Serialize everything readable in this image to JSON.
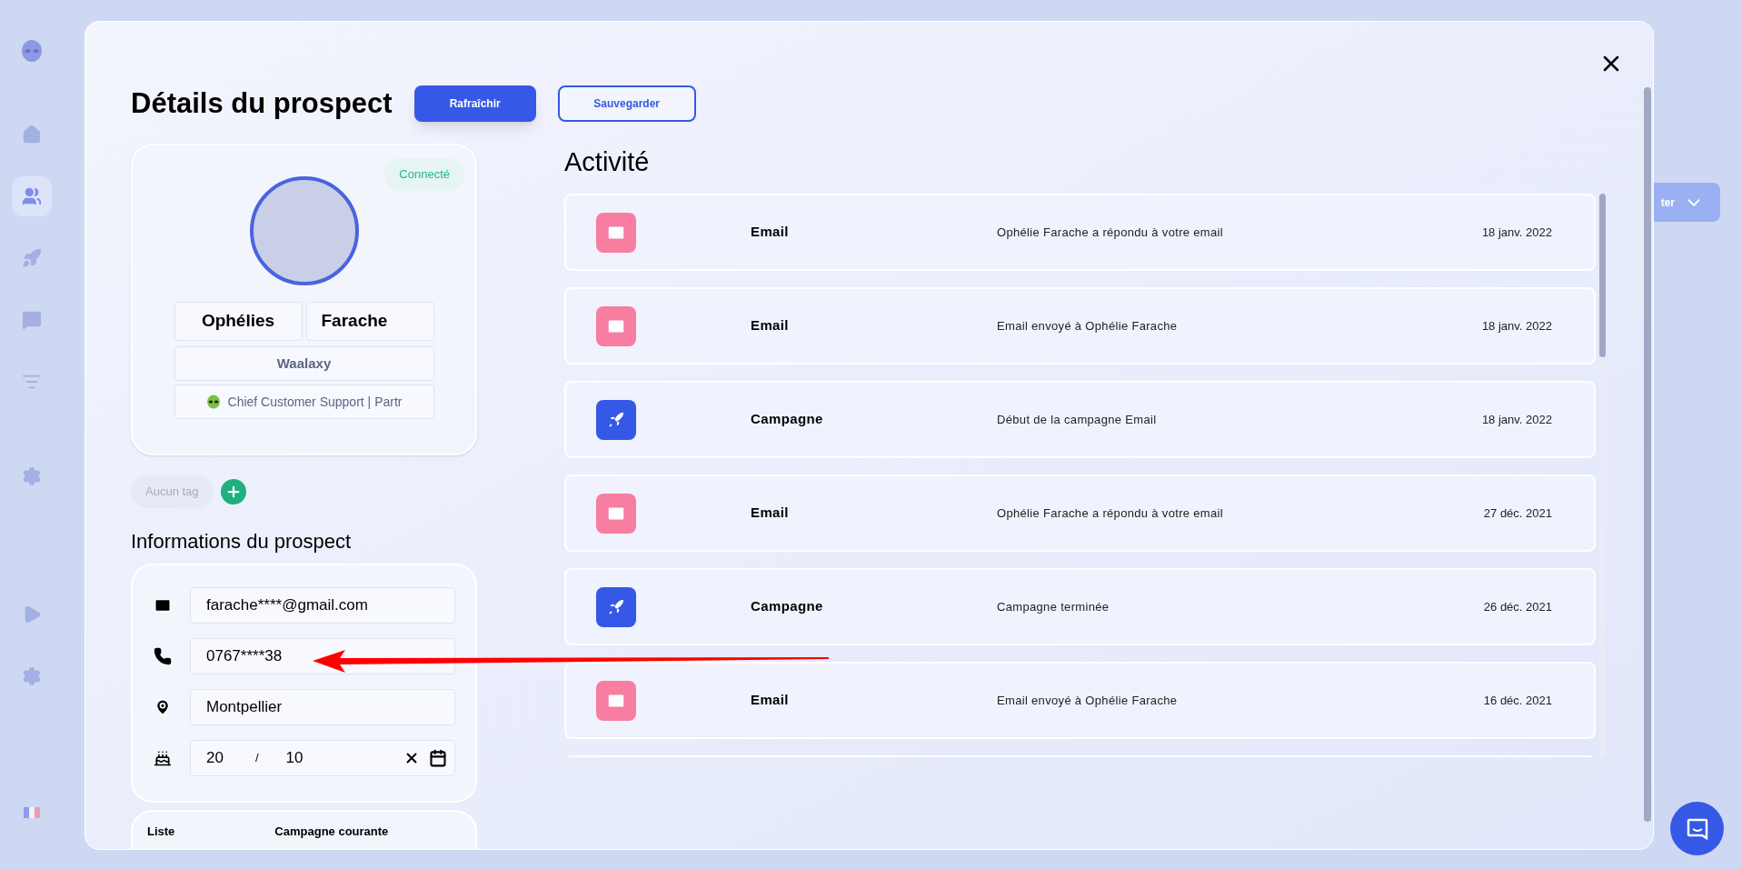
{
  "app_sidebar": {
    "items": [
      {
        "selected": false
      },
      {
        "selected": true
      },
      {
        "selected": false
      },
      {
        "selected": false
      },
      {
        "selected": false
      },
      {
        "selected": false
      },
      {
        "selected": false
      },
      {
        "selected": false
      }
    ]
  },
  "background_button": {
    "label": "ter"
  },
  "modal": {
    "title": "Détails du prospect",
    "buttons": [
      {
        "label": "Rafraîchir",
        "kind": "primary"
      },
      {
        "label": "Sauvegarder",
        "kind": "outline"
      }
    ]
  },
  "profile": {
    "status": "Connecté",
    "first_name": "Ophélies",
    "last_name": "Farache",
    "company": "Waalaxy",
    "job_title": "Chief Customer Support | Partr"
  },
  "tags": {
    "placeholder": "Aucun tag"
  },
  "info": {
    "title": "Informations du prospect",
    "fields": [
      {
        "kind": "email",
        "value": "farache****@gmail.com"
      },
      {
        "kind": "phone",
        "value": "0767****38"
      },
      {
        "kind": "location",
        "value": "Montpellier"
      },
      {
        "kind": "birthday",
        "day": "20",
        "separator": "/",
        "month": "10"
      }
    ]
  },
  "bottom_card": {
    "columns": [
      "Liste",
      "Campagne courante"
    ]
  },
  "activity": {
    "title": "Activité",
    "rows": [
      {
        "kind": "email",
        "type": "Email",
        "description": "Ophélie Farache a répondu à votre email",
        "date": "18 janv. 2022"
      },
      {
        "kind": "email",
        "type": "Email",
        "description": "Email envoyé à Ophélie Farache",
        "date": "18 janv. 2022"
      },
      {
        "kind": "campaign",
        "type": "Campagne",
        "description": "Début de la campagne Email",
        "date": "18 janv. 2022"
      },
      {
        "kind": "email",
        "type": "Email",
        "description": "Ophélie Farache a répondu à votre email",
        "date": "27 déc. 2021"
      },
      {
        "kind": "campaign",
        "type": "Campagne",
        "description": "Campagne terminée",
        "date": "26 déc. 2021"
      },
      {
        "kind": "email",
        "type": "Email",
        "description": "Email envoyé à Ophélie Farache",
        "date": "16 déc. 2021"
      }
    ]
  }
}
